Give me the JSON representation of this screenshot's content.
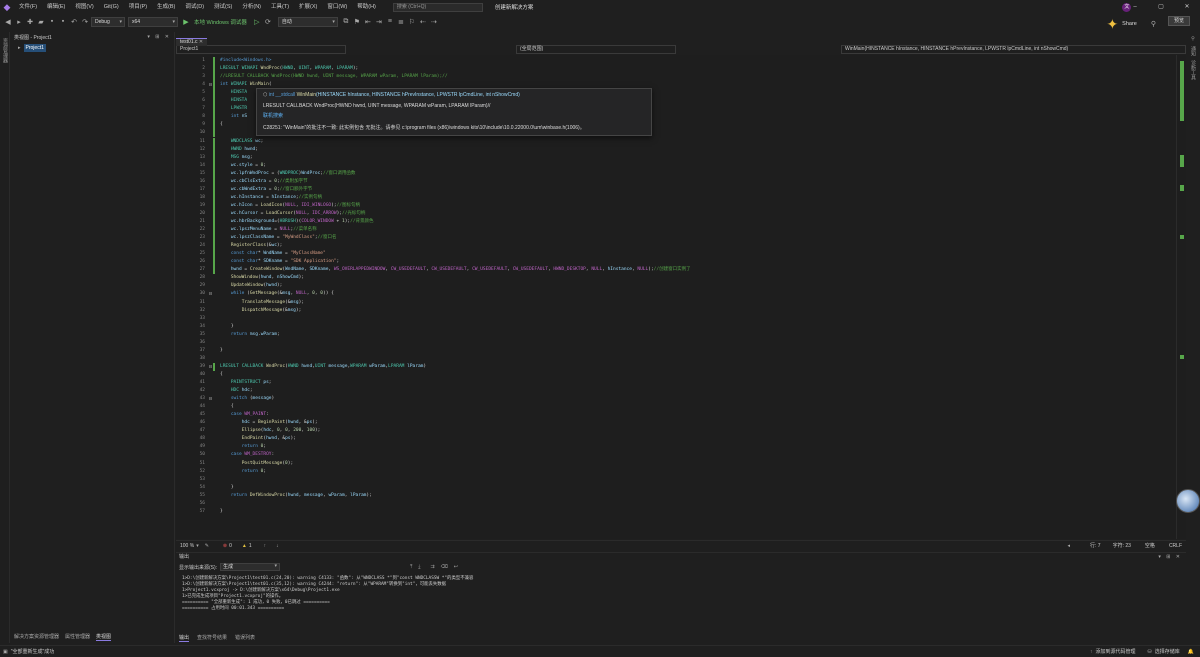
{
  "menu": [
    "文件(F)",
    "编辑(E)",
    "视图(V)",
    "Git(G)",
    "项目(P)",
    "生成(B)",
    "调试(D)",
    "测试(S)",
    "分析(N)",
    "工具(T)",
    "扩展(X)",
    "窗口(W)",
    "帮助(H)"
  ],
  "search_placeholder": "搜索 (Ctrl+Q)",
  "solution_name": "创建新解决方案",
  "toolbar": {
    "config": "Debug",
    "platform": "x64",
    "run_label": "本地 Windows 调试器",
    "auto": "自动"
  },
  "share_label": "Share",
  "preview_label": "预览",
  "left_strip_label": "资源管理器",
  "class_view": {
    "title": "类视图 - Project1",
    "project": "Project1"
  },
  "class_tabs": [
    "解决方案资源管理器",
    "属性管理器",
    "类视图"
  ],
  "editor": {
    "tab": "test01.c",
    "scope": "Project1",
    "global": "(全局范围)",
    "func": "WinMain(HINSTANCE hInstance, HINSTANCE hPrevInstance, LPWSTR lpCmdLine, int nShowCmd)"
  },
  "code": [
    {
      "n": "1",
      "t": "#include<Windows.h>"
    },
    {
      "n": "2",
      "t": "LRESULT WINAPI WndProc(HWND, UINT, WPARAM, LPARAM);"
    },
    {
      "n": "3",
      "t": "//LRESULT CALLBACK WndProc(HWND hwnd, UINT message, WPARAM wParam, LPARAM lParam);//"
    },
    {
      "n": "4",
      "t": "int WINAPI WinMain("
    },
    {
      "n": "5",
      "t": "    HINSTA"
    },
    {
      "n": "6",
      "t": "    HINSTA"
    },
    {
      "n": "7",
      "t": "    LPWSTR"
    },
    {
      "n": "8",
      "t": "    int nS"
    },
    {
      "n": "9",
      "t": "{"
    },
    {
      "n": "10",
      "t": ""
    },
    {
      "n": "11",
      "t": "    WNDCLASS wc;"
    },
    {
      "n": "12",
      "t": "    HWND hwnd;"
    },
    {
      "n": "13",
      "t": "    MSG msg;"
    },
    {
      "n": "14",
      "t": "    wc.style = 0;"
    },
    {
      "n": "15",
      "t": "    wc.lpfnWndProc = (WNDPROC)WndProc;//窗口调用函数"
    },
    {
      "n": "16",
      "t": "    wc.cbClsExtra = 0;//类附加字节"
    },
    {
      "n": "17",
      "t": "    wc.cbWndExtra = 0;//窗口额外字节"
    },
    {
      "n": "18",
      "t": "    wc.hInstance = hInstance;//实例句柄"
    },
    {
      "n": "19",
      "t": "    wc.hIcon = LoadIcon(NULL, IDI_WINLOGO);//图标句柄"
    },
    {
      "n": "20",
      "t": "    wc.hCursor = LoadCursor(NULL, IDC_ARROW);//光标句柄"
    },
    {
      "n": "21",
      "t": "    wc.hbrBackground=(HBRUSH)(COLOR_WINDOW + 1);//背景颜色"
    },
    {
      "n": "22",
      "t": "    wc.lpszMenuName = NULL;//菜单名称"
    },
    {
      "n": "23",
      "t": "    wc.lpszClassName = \"MyWndClass\";//窗口名"
    },
    {
      "n": "24",
      "t": "    RegisterClass(&wc);"
    },
    {
      "n": "25",
      "t": "    const char* WndName = \"MyClassName\""
    },
    {
      "n": "26",
      "t": "    const char* SDKname = \"SDK Application\";"
    },
    {
      "n": "27",
      "t": "    hwnd = CreateWindow(WndName, SDKname, WS_OVERLAPPEDWINDOW, CW_USEDEFAULT, CW_USEDEFAULT, CW_USEDEFAULT, CW_USEDEFAULT, HWND_DESKTOP, NULL, hInstance, NULL);//创建窗口实例了"
    },
    {
      "n": "28",
      "t": "    ShowWindow(hwnd, nShowCmd);"
    },
    {
      "n": "29",
      "t": "    UpdateWindow(hwnd);"
    },
    {
      "n": "30",
      "t": "    while (GetMessage(&msg, NULL, 0, 0)) {"
    },
    {
      "n": "31",
      "t": "        TranslateMessage(&msg);"
    },
    {
      "n": "32",
      "t": "        DispatchMessage(&msg);"
    },
    {
      "n": "33",
      "t": ""
    },
    {
      "n": "34",
      "t": "    }"
    },
    {
      "n": "35",
      "t": "    return msg.wParam;"
    },
    {
      "n": "36",
      "t": ""
    },
    {
      "n": "37",
      "t": "}"
    },
    {
      "n": "38",
      "t": ""
    },
    {
      "n": "39",
      "t": "LRESULT CALLBACK WndProc(HWND hwnd,UINT message,WPARAM wParam,LPARAM lParam)"
    },
    {
      "n": "40",
      "t": "{"
    },
    {
      "n": "41",
      "t": "    PAINTSTRUCT ps;"
    },
    {
      "n": "42",
      "t": "    HDC hdc;"
    },
    {
      "n": "43",
      "t": "    switch (message)"
    },
    {
      "n": "44",
      "t": "    {"
    },
    {
      "n": "45",
      "t": "    case WM_PAINT:"
    },
    {
      "n": "46",
      "t": "        hdc = BeginPaint(hwnd, &ps);"
    },
    {
      "n": "47",
      "t": "        Ellipse(hdc, 0, 0, 200, 100);"
    },
    {
      "n": "48",
      "t": "        EndPaint(hwnd, &ps);"
    },
    {
      "n": "49",
      "t": "        return 0;"
    },
    {
      "n": "50",
      "t": "    case WM_DESTROY:"
    },
    {
      "n": "51",
      "t": "        PostQuitMessage(0);"
    },
    {
      "n": "52",
      "t": "        return 0;"
    },
    {
      "n": "53",
      "t": ""
    },
    {
      "n": "54",
      "t": "    }"
    },
    {
      "n": "55",
      "t": "    return DefWindowProc(hwnd, message, wParam, lParam);"
    },
    {
      "n": "56",
      "t": ""
    },
    {
      "n": "57",
      "t": "}"
    }
  ],
  "tooltip": {
    "line1_prefix": "int __stdcall",
    "line1_func": "WinMain",
    "line1_rest": "(HINSTANCE hInstance, HINSTANCE hPrevInstance, LPWSTR lpCmdLine, int nShowCmd)",
    "line2": "LRESULT CALLBACK WndProc(HWND hwnd, UINT message, WPARAM wParam, LPARAM lParam)//",
    "link": "联机搜索",
    "warning": "C28251: \"WinMain\"的批注不一致: 此实例包含 无批注。请参见 c:\\program files (x86)\\windows kits\\10\\include\\10.0.22000.0\\um\\winbase.h(1006)。"
  },
  "status_editor": {
    "zoom": "100 %",
    "errors": "0",
    "warnings": "1",
    "line": "行: 7",
    "col": "字符: 23",
    "ws": "空格",
    "eol": "CRLF"
  },
  "output": {
    "title": "输出",
    "src_label": "显示输出来源(S):",
    "src_value": "生成",
    "lines": [
      "1>D:\\创建新解决方案\\Project1\\test01.c(24,20): warning C4133: \"函数\": 从\"WNDCLASS *\"到\"const WNDCLASSW *\"的类型不兼容",
      "1>D:\\创建新解决方案\\Project1\\test01.c(35,12): warning C4244: \"return\": 从\"WPARAM\"转换到\"int\"，可能丢失数据",
      "1>Project1.vcxproj -> D:\\创建新解决方案\\x64\\Debug\\Project1.exe",
      "1>已完成生成项目\"Project1.vcxproj\"的操作。",
      "========== \"全部重新生成\": 1 成功，0 失败，0已跳过 ==========",
      "========== 占用时间 00:01.343 =========="
    ],
    "tabs": [
      "输出",
      "查找符号结果",
      "错误列表"
    ]
  },
  "statusbar": {
    "left": "\"全部重新生成\"成功",
    "source_ctrl": "添加到源代码管理",
    "repo": "选择存储库"
  }
}
